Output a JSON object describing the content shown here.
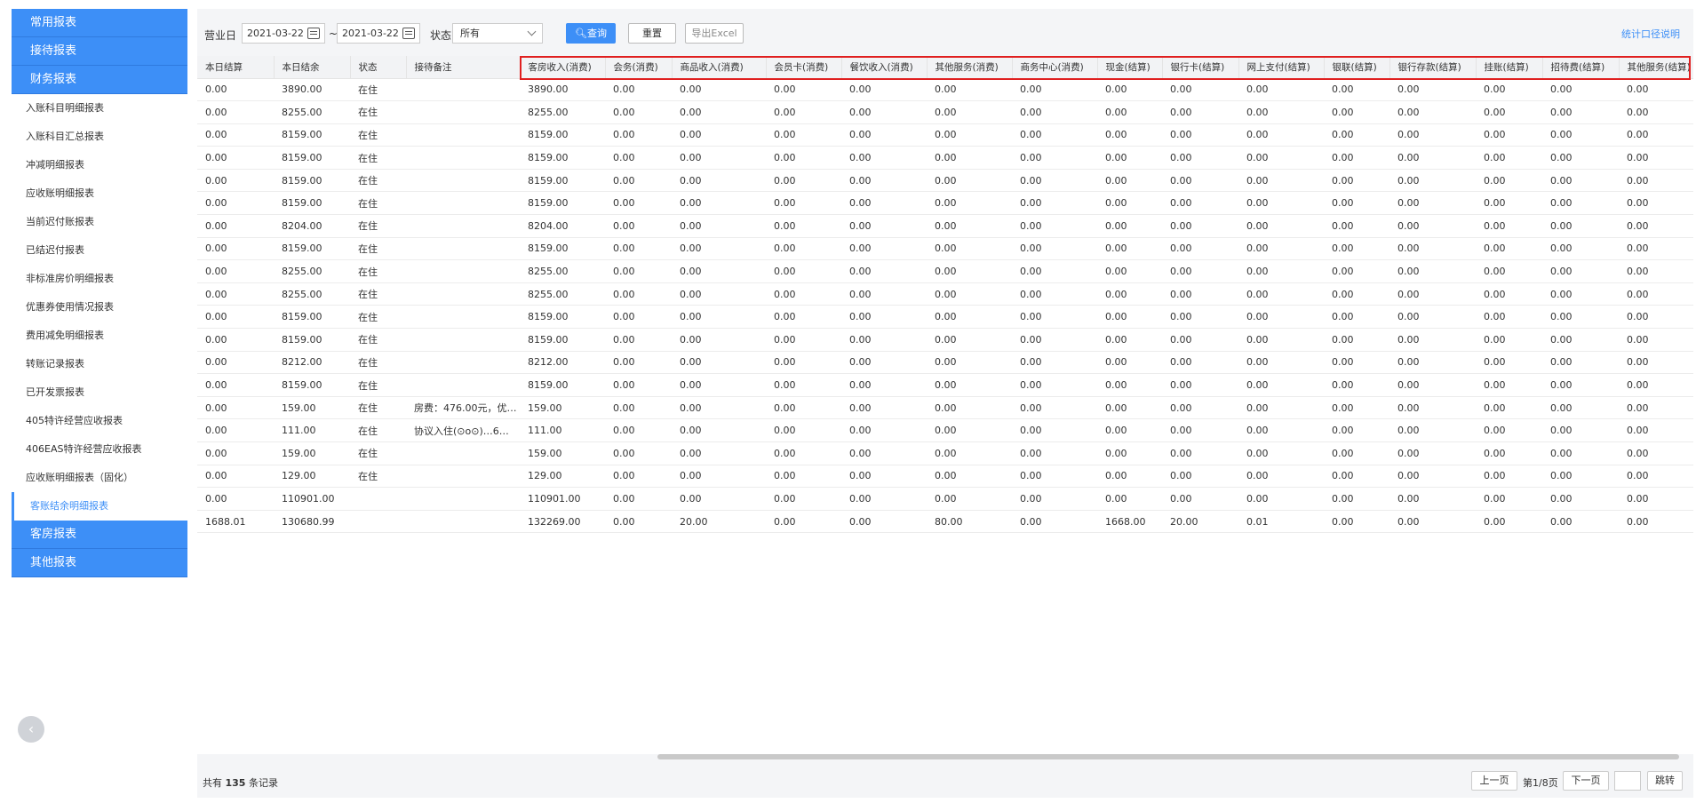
{
  "sidebar": {
    "groups_top": [
      "常用报表",
      "接待报表",
      "财务报表"
    ],
    "items": [
      "入账科目明细报表",
      "入账科目汇总报表",
      "冲减明细报表",
      "应收账明细报表",
      "当前迟付账报表",
      "已结迟付报表",
      "非标准房价明细报表",
      "优惠券使用情况报表",
      "费用减免明细报表",
      "转账记录报表",
      "已开发票报表",
      "405特许经营应收报表",
      "406EAS特许经营应收报表",
      "应收账明细报表（固化）",
      "客账结余明细报表"
    ],
    "groups_bottom": [
      "客房报表",
      "其他报表"
    ],
    "collapse_icon": "‹"
  },
  "toolbar": {
    "date_label": "营业日",
    "date_from": "2021-03-22",
    "date_sep": "~",
    "date_to": "2021-03-22",
    "status_label": "状态",
    "status_value": "所有",
    "query_label": "查询",
    "reset_label": "重置",
    "export_label": "导出Excel",
    "stats_link": "统计口径说明"
  },
  "table": {
    "columns": [
      "本日结算",
      "本日结余",
      "状态",
      "接待备注",
      "客房收入(消费)",
      "会务(消费)",
      "商品收入(消费)",
      "会员卡(消费)",
      "餐饮收入(消费)",
      "其他服务(消费)",
      "商务中心(消费)",
      "现金(结算)",
      "银行卡(结算)",
      "网上支付(结算)",
      "银联(结算)",
      "银行存款(结算)",
      "挂账(结算)",
      "招待费(结算)",
      "其他服务(结算)"
    ],
    "rows": [
      [
        "0.00",
        "3890.00",
        "在住",
        "",
        "3890.00",
        "0.00",
        "0.00",
        "0.00",
        "0.00",
        "0.00",
        "0.00",
        "0.00",
        "0.00",
        "0.00",
        "0.00",
        "0.00",
        "0.00",
        "0.00",
        "0.00"
      ],
      [
        "0.00",
        "8255.00",
        "在住",
        "",
        "8255.00",
        "0.00",
        "0.00",
        "0.00",
        "0.00",
        "0.00",
        "0.00",
        "0.00",
        "0.00",
        "0.00",
        "0.00",
        "0.00",
        "0.00",
        "0.00",
        "0.00"
      ],
      [
        "0.00",
        "8159.00",
        "在住",
        "",
        "8159.00",
        "0.00",
        "0.00",
        "0.00",
        "0.00",
        "0.00",
        "0.00",
        "0.00",
        "0.00",
        "0.00",
        "0.00",
        "0.00",
        "0.00",
        "0.00",
        "0.00"
      ],
      [
        "0.00",
        "8159.00",
        "在住",
        "",
        "8159.00",
        "0.00",
        "0.00",
        "0.00",
        "0.00",
        "0.00",
        "0.00",
        "0.00",
        "0.00",
        "0.00",
        "0.00",
        "0.00",
        "0.00",
        "0.00",
        "0.00"
      ],
      [
        "0.00",
        "8159.00",
        "在住",
        "",
        "8159.00",
        "0.00",
        "0.00",
        "0.00",
        "0.00",
        "0.00",
        "0.00",
        "0.00",
        "0.00",
        "0.00",
        "0.00",
        "0.00",
        "0.00",
        "0.00",
        "0.00"
      ],
      [
        "0.00",
        "8159.00",
        "在住",
        "",
        "8159.00",
        "0.00",
        "0.00",
        "0.00",
        "0.00",
        "0.00",
        "0.00",
        "0.00",
        "0.00",
        "0.00",
        "0.00",
        "0.00",
        "0.00",
        "0.00",
        "0.00"
      ],
      [
        "0.00",
        "8204.00",
        "在住",
        "",
        "8204.00",
        "0.00",
        "0.00",
        "0.00",
        "0.00",
        "0.00",
        "0.00",
        "0.00",
        "0.00",
        "0.00",
        "0.00",
        "0.00",
        "0.00",
        "0.00",
        "0.00"
      ],
      [
        "0.00",
        "8159.00",
        "在住",
        "",
        "8159.00",
        "0.00",
        "0.00",
        "0.00",
        "0.00",
        "0.00",
        "0.00",
        "0.00",
        "0.00",
        "0.00",
        "0.00",
        "0.00",
        "0.00",
        "0.00",
        "0.00"
      ],
      [
        "0.00",
        "8255.00",
        "在住",
        "",
        "8255.00",
        "0.00",
        "0.00",
        "0.00",
        "0.00",
        "0.00",
        "0.00",
        "0.00",
        "0.00",
        "0.00",
        "0.00",
        "0.00",
        "0.00",
        "0.00",
        "0.00"
      ],
      [
        "0.00",
        "8255.00",
        "在住",
        "",
        "8255.00",
        "0.00",
        "0.00",
        "0.00",
        "0.00",
        "0.00",
        "0.00",
        "0.00",
        "0.00",
        "0.00",
        "0.00",
        "0.00",
        "0.00",
        "0.00",
        "0.00"
      ],
      [
        "0.00",
        "8159.00",
        "在住",
        "",
        "8159.00",
        "0.00",
        "0.00",
        "0.00",
        "0.00",
        "0.00",
        "0.00",
        "0.00",
        "0.00",
        "0.00",
        "0.00",
        "0.00",
        "0.00",
        "0.00",
        "0.00"
      ],
      [
        "0.00",
        "8159.00",
        "在住",
        "",
        "8159.00",
        "0.00",
        "0.00",
        "0.00",
        "0.00",
        "0.00",
        "0.00",
        "0.00",
        "0.00",
        "0.00",
        "0.00",
        "0.00",
        "0.00",
        "0.00",
        "0.00"
      ],
      [
        "0.00",
        "8212.00",
        "在住",
        "",
        "8212.00",
        "0.00",
        "0.00",
        "0.00",
        "0.00",
        "0.00",
        "0.00",
        "0.00",
        "0.00",
        "0.00",
        "0.00",
        "0.00",
        "0.00",
        "0.00",
        "0.00"
      ],
      [
        "0.00",
        "8159.00",
        "在住",
        "",
        "8159.00",
        "0.00",
        "0.00",
        "0.00",
        "0.00",
        "0.00",
        "0.00",
        "0.00",
        "0.00",
        "0.00",
        "0.00",
        "0.00",
        "0.00",
        "0.00",
        "0.00"
      ],
      [
        "0.00",
        "159.00",
        "在住",
        "房费：476.00元，优…",
        "159.00",
        "0.00",
        "0.00",
        "0.00",
        "0.00",
        "0.00",
        "0.00",
        "0.00",
        "0.00",
        "0.00",
        "0.00",
        "0.00",
        "0.00",
        "0.00",
        "0.00"
      ],
      [
        "0.00",
        "111.00",
        "在住",
        "协议入住(⊙o⊙)…6…",
        "111.00",
        "0.00",
        "0.00",
        "0.00",
        "0.00",
        "0.00",
        "0.00",
        "0.00",
        "0.00",
        "0.00",
        "0.00",
        "0.00",
        "0.00",
        "0.00",
        "0.00"
      ],
      [
        "0.00",
        "159.00",
        "在住",
        "",
        "159.00",
        "0.00",
        "0.00",
        "0.00",
        "0.00",
        "0.00",
        "0.00",
        "0.00",
        "0.00",
        "0.00",
        "0.00",
        "0.00",
        "0.00",
        "0.00",
        "0.00"
      ],
      [
        "0.00",
        "129.00",
        "在住",
        "",
        "129.00",
        "0.00",
        "0.00",
        "0.00",
        "0.00",
        "0.00",
        "0.00",
        "0.00",
        "0.00",
        "0.00",
        "0.00",
        "0.00",
        "0.00",
        "0.00",
        "0.00"
      ],
      [
        "0.00",
        "110901.00",
        "",
        "",
        "110901.00",
        "0.00",
        "0.00",
        "0.00",
        "0.00",
        "0.00",
        "0.00",
        "0.00",
        "0.00",
        "0.00",
        "0.00",
        "0.00",
        "0.00",
        "0.00",
        "0.00"
      ],
      [
        "1688.01",
        "130680.99",
        "",
        "",
        "132269.00",
        "0.00",
        "20.00",
        "0.00",
        "0.00",
        "80.00",
        "0.00",
        "1668.00",
        "20.00",
        "0.01",
        "0.00",
        "0.00",
        "0.00",
        "0.00",
        "0.00"
      ]
    ]
  },
  "footer": {
    "total_prefix": "共有",
    "total_count": "135",
    "total_suffix": "条记录",
    "prev_label": "上一页",
    "page_info": "第1/8页",
    "next_label": "下一页",
    "jump_label": "跳转"
  },
  "colors": {
    "accent": "#3d8ff7",
    "highlight": "#e02020"
  }
}
